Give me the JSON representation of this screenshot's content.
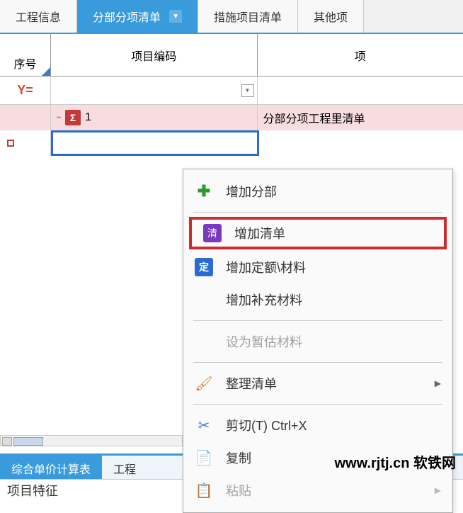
{
  "tabs": {
    "engineering_info": "工程信息",
    "section_list": "分部分项清单",
    "measure_list": "措施项目清单",
    "other_items": "其他项"
  },
  "columns": {
    "seq": "序号",
    "code": "项目编码",
    "name": "项"
  },
  "row1": {
    "number": "1",
    "name": "分部分项工程里清单"
  },
  "context_menu": {
    "add_section": "增加分部",
    "add_list": "增加清单",
    "add_quota": "增加定额\\材料",
    "add_supplement": "增加补充材料",
    "set_provisional": "设为暂估材料",
    "organize_list": "整理清单",
    "cut": "剪切(T)",
    "cut_shortcut": "Ctrl+X",
    "copy": "复制",
    "paste": "粘贴"
  },
  "bottom_tabs": {
    "price_sheet": "综合单价计算表",
    "engineering": "工程"
  },
  "watermark": "www.rjtj.cn 软铁网",
  "bottom_fragment": "项目特征"
}
